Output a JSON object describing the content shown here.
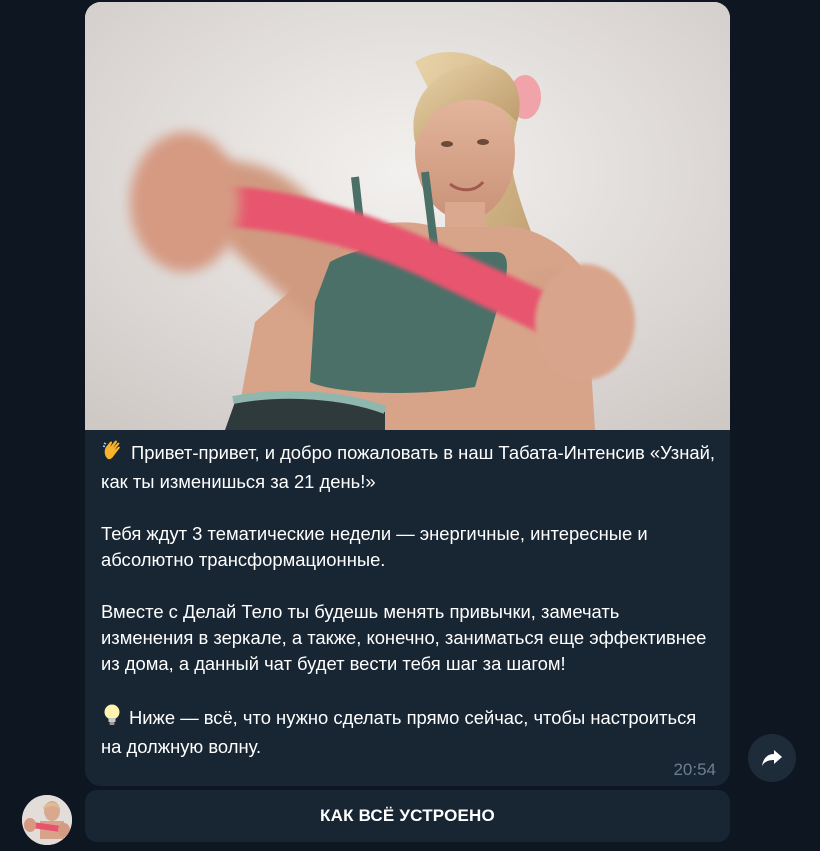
{
  "message": {
    "paragraphs": [
      {
        "icon": "waving-hand-emoji",
        "text": "Привет-привет, и добро пожаловать в наш Табата-Интенсив «Узнай, как ты изменишься за 21 день!»"
      },
      {
        "text": "Тебя ждут 3 тематические недели — энергичные, интересные и абсолютно трансформационные."
      },
      {
        "text": "Вместе с Делай Тело ты будешь менять привычки, замечать изменения в зеркале, а также, конечно, заниматься еще эффективнее из дома, а данный чат будет вести тебя шаг за шагом!"
      },
      {
        "icon": "light-bulb-emoji",
        "text": "Ниже — всё, что нужно сделать прямо сейчас, чтобы настроиться на должную волну."
      }
    ],
    "time": "20:54"
  },
  "keyboard": {
    "button_label": "КАК ВСЁ УСТРОЕНО"
  },
  "icons": {
    "share": "share-arrow-icon",
    "avatar": "sender-avatar"
  },
  "colors": {
    "background": "#0e1621",
    "bubble": "#182533",
    "band": "#e8546e",
    "top": "#4a7068"
  }
}
